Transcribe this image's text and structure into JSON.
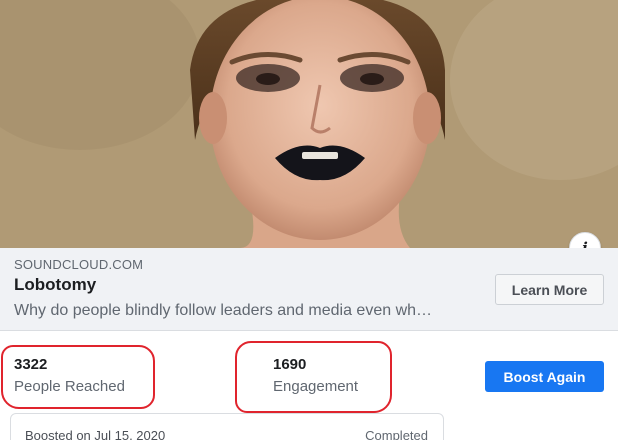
{
  "ad": {
    "image_alt": "portrait of woman with black lipstick",
    "info_icon": "info-icon"
  },
  "link": {
    "domain": "SOUNDCLOUD.COM",
    "title": "Lobotomy",
    "description": "Why do people blindly follow leaders and media even wh…",
    "cta_label": "Learn More"
  },
  "stats": {
    "people_reached": {
      "value": "3322",
      "label": "People Reached"
    },
    "engagement": {
      "value": "1690",
      "label": "Engagement"
    }
  },
  "actions": {
    "boost_again_label": "Boost Again"
  },
  "boost": {
    "date_text": "Boosted on Jul 15, 2020",
    "status": "Completed"
  },
  "colors": {
    "accent": "#1877f2",
    "annotation_red": "#e0242d"
  }
}
